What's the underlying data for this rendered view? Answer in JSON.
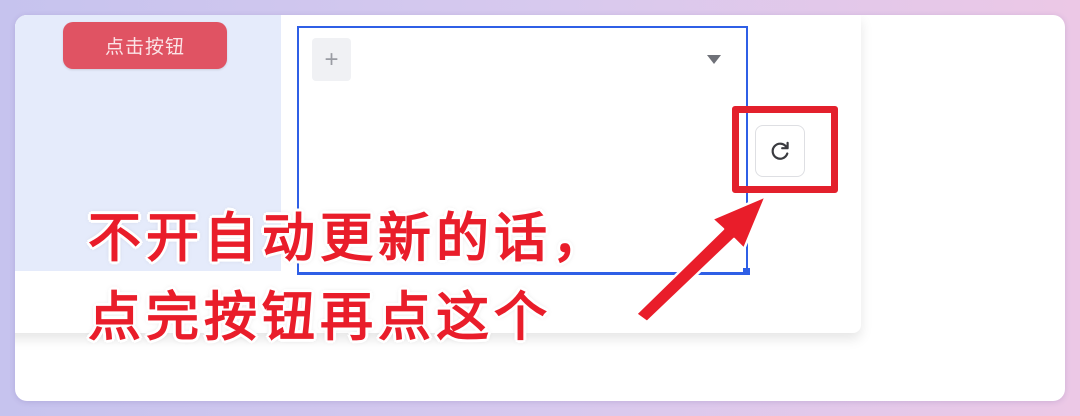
{
  "toolbar": {
    "action_button_label": "点击按钮",
    "add_button_label": "+"
  },
  "dropdown": {
    "caret_icon": "caret-down-icon"
  },
  "refresh": {
    "icon": "refresh-icon"
  },
  "annotation": {
    "line1": "不开自动更新的话，",
    "line2": "点完按钮再点这个"
  },
  "colors": {
    "action_button": "#e05363",
    "selection_border": "#2f5fe6",
    "highlight": "#e3202c",
    "annotation_text": "#e91d2a"
  }
}
